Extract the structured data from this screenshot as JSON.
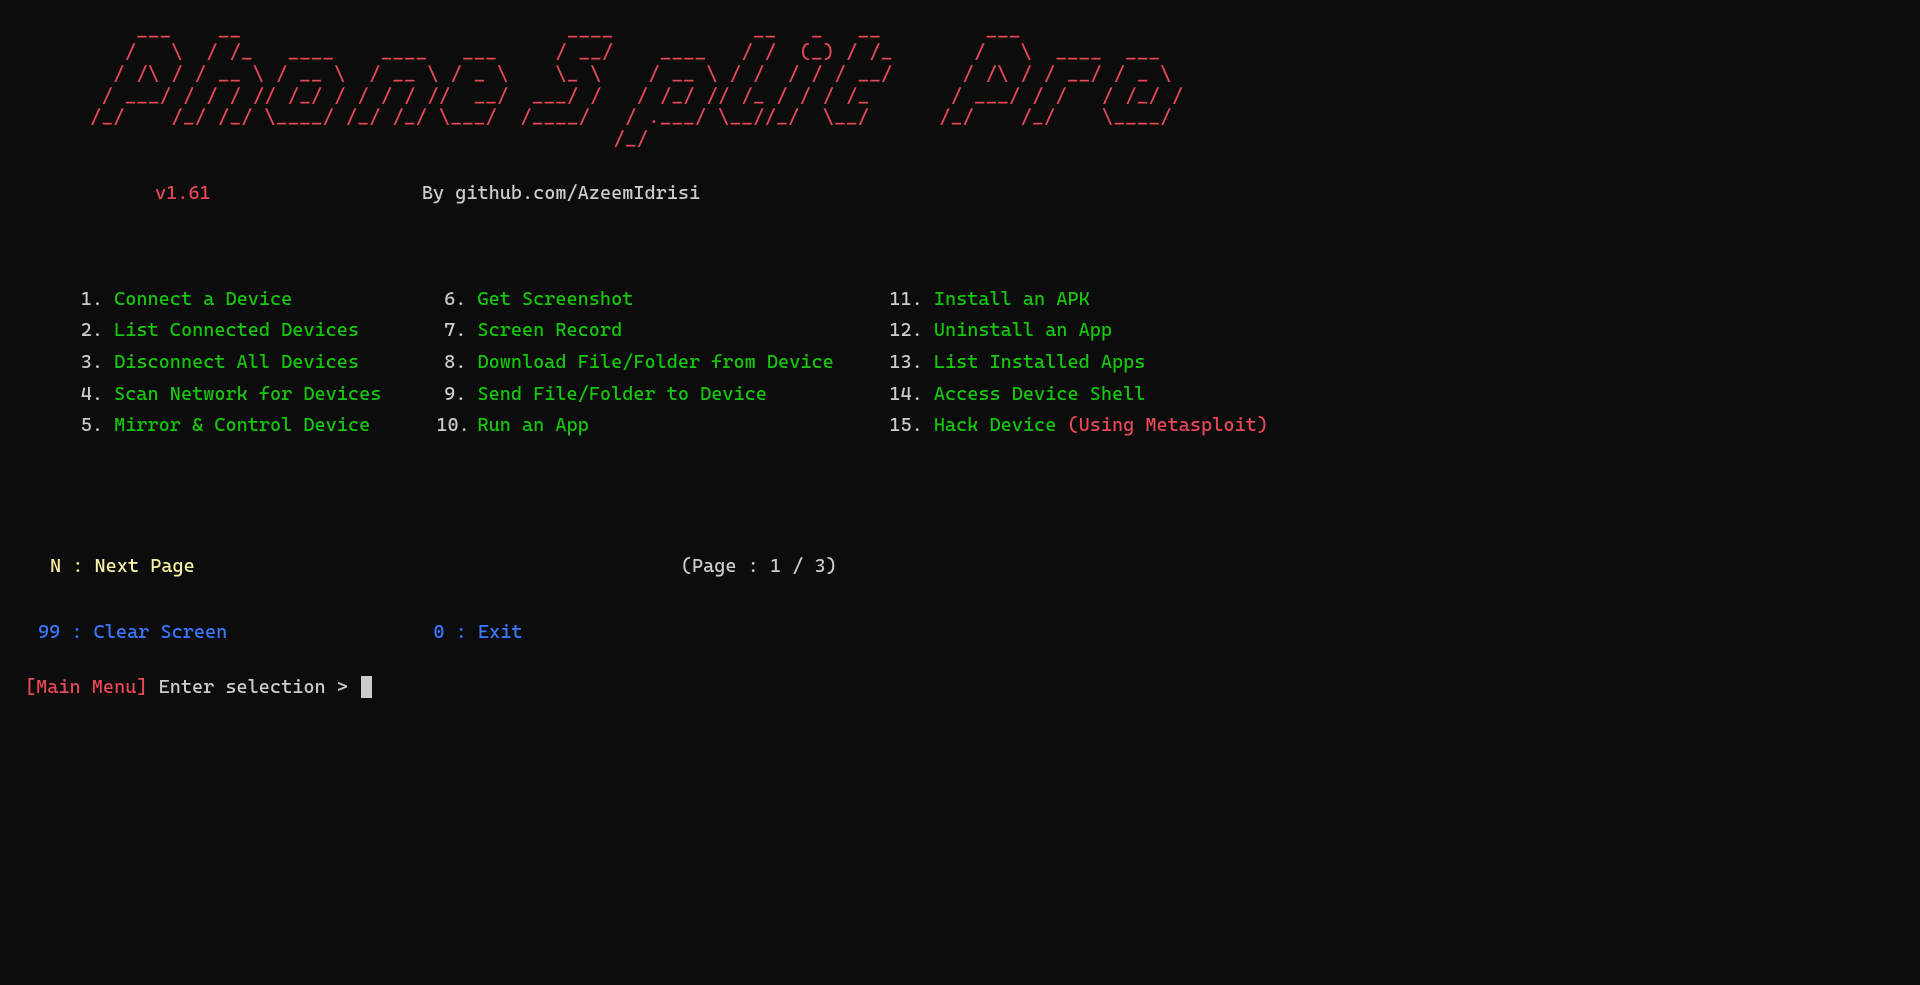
{
  "ascii_art": "    ___    __                            ____            __   _   __         ___               \n   /   \\  / /_   ____    ____   ___     / __/    ____   / /  (_) / /_       /   \\  ____  ___   \n  / /\\ / / __ \\ / __ \\  / __ \\ / _ \\    \\_ \\    / __ \\ / /  / / / __/      / /\\ / / __/ / _ \\  \n / ___/ / / / // /_/ / / / / //  __/  ___/ /   / /_/ // /_ / / / /_       / ___/ / /   / /_/ / \n/_/    /_/ /_/ \\____/ /_/ /_/ \\___/  /____/   / .___/ \\__//_/  \\__/      /_/    /_/    \\____/ \n                                             /_/                                               ",
  "version": "v1.61",
  "by_text": "By github.com/AzeemIdrisi",
  "menu": {
    "col1": [
      {
        "num": "1.",
        "label": "Connect a Device"
      },
      {
        "num": "2.",
        "label": "List Connected Devices"
      },
      {
        "num": "3.",
        "label": "Disconnect All Devices"
      },
      {
        "num": "4.",
        "label": "Scan Network for Devices"
      },
      {
        "num": "5.",
        "label": "Mirror & Control Device"
      }
    ],
    "col2": [
      {
        "num": "6.",
        "label": "Get Screenshot"
      },
      {
        "num": "7.",
        "label": "Screen Record"
      },
      {
        "num": "8.",
        "label": "Download File/Folder from Device"
      },
      {
        "num": "9.",
        "label": "Send File/Folder to Device"
      },
      {
        "num": "10.",
        "label": "Run an App"
      }
    ],
    "col3": [
      {
        "num": "11.",
        "label": "Install an APK"
      },
      {
        "num": "12.",
        "label": "Uninstall an App"
      },
      {
        "num": "13.",
        "label": "List Installed Apps"
      },
      {
        "num": "14.",
        "label": "Access Device Shell"
      },
      {
        "num": "15.",
        "label": "Hack Device ",
        "extra": "(Using Metasploit)"
      }
    ]
  },
  "nav": {
    "next_page": "N : Next Page",
    "page_info": "(Page : 1 / 3)"
  },
  "actions": {
    "clear_screen": "99 : Clear Screen",
    "exit": "0 : Exit"
  },
  "prompt": {
    "menu_label": "[Main Menu]",
    "text": " Enter selection > "
  }
}
